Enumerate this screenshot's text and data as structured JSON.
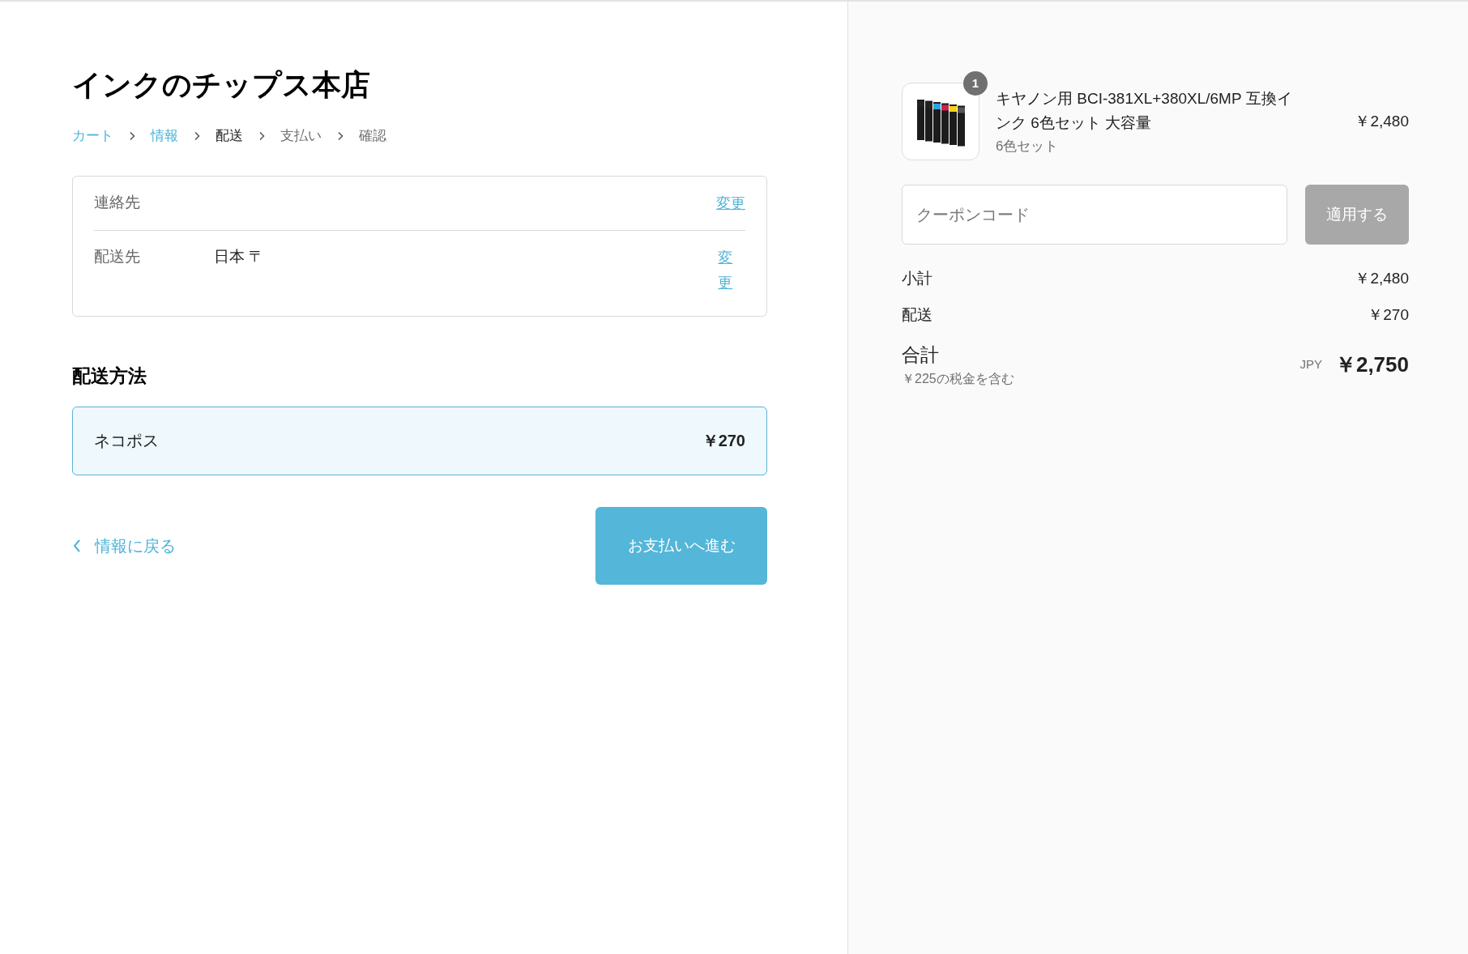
{
  "shop": {
    "title": "インクのチップス本店"
  },
  "breadcrumb": [
    {
      "label": "カート",
      "kind": "link"
    },
    {
      "label": "情報",
      "kind": "link"
    },
    {
      "label": "配送",
      "kind": "current"
    },
    {
      "label": "支払い",
      "kind": "pending"
    },
    {
      "label": "確認",
      "kind": "pending"
    }
  ],
  "review": [
    {
      "label": "連絡先",
      "action": "変更"
    },
    {
      "label": "配送先",
      "value": "日本 〒",
      "action": "変更"
    }
  ],
  "shipping_method": {
    "heading": "配送方法",
    "options": [
      {
        "name": "ネコポス",
        "price": "￥270",
        "selected": true
      }
    ]
  },
  "back_link": "情報に戻る",
  "continue_button": "お支払いへ進む",
  "cart": {
    "items": [
      {
        "quantity": "1",
        "title": "キヤノン用 BCI-381XL+380XL/6MP 互換インク 6色セット 大容量",
        "variant": "6色セット",
        "price": "￥2,480"
      }
    ]
  },
  "coupon": {
    "placeholder": "クーポンコード",
    "button": "適用する",
    "disabled": true
  },
  "totals": [
    {
      "label": "小計",
      "value": "￥2,480"
    },
    {
      "label": "配送",
      "value": "￥270"
    }
  ],
  "total": {
    "label": "合計",
    "tax_note": "￥225の税金を含む",
    "currency": "JPY",
    "value": "￥2,750"
  }
}
